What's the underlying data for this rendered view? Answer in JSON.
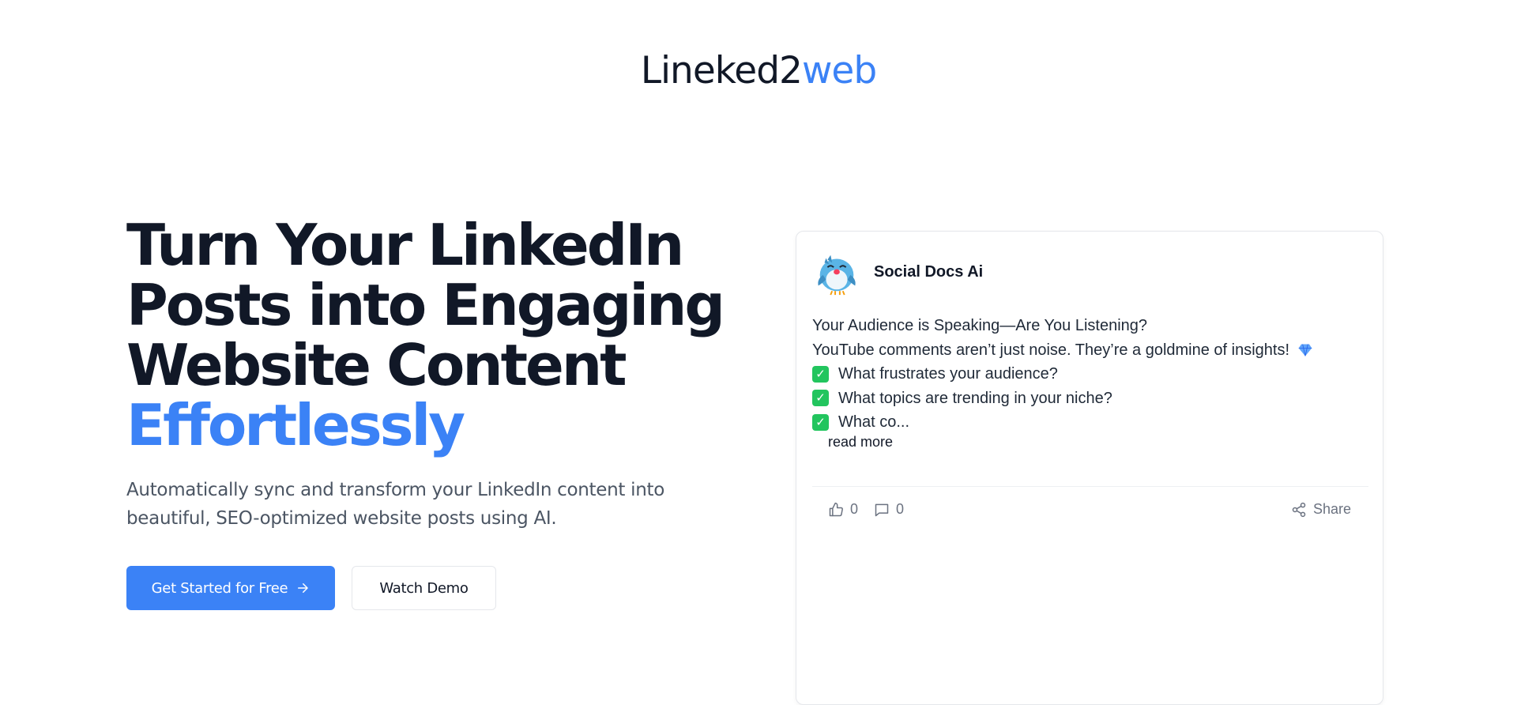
{
  "header": {
    "logo_main": "Lineked2",
    "logo_accent": "web",
    "brand_color": "#3b82f6"
  },
  "hero": {
    "title_lines": [
      "Turn Your LinkedIn",
      "Posts into Engaging",
      "Website Content"
    ],
    "title_accent": "Effortlessly",
    "subtitle": "Automatically sync and transform your LinkedIn content into beautiful, SEO-optimized website posts using AI.",
    "primary_button": "Get Started for Free",
    "secondary_button": "Watch Demo"
  },
  "post": {
    "author": "Social Docs Ai",
    "avatar_icon": "bird-avatar-icon",
    "lines": [
      "Your Audience is Speaking—Are You Listening?",
      "YouTube comments aren’t just noise. They’re a goldmine of insights!"
    ],
    "checklist": [
      "What frustrates your audience?",
      "What topics are trending in your niche?",
      "What co..."
    ],
    "read_more": "read more",
    "likes": "0",
    "comments": "0",
    "share": "Share"
  }
}
